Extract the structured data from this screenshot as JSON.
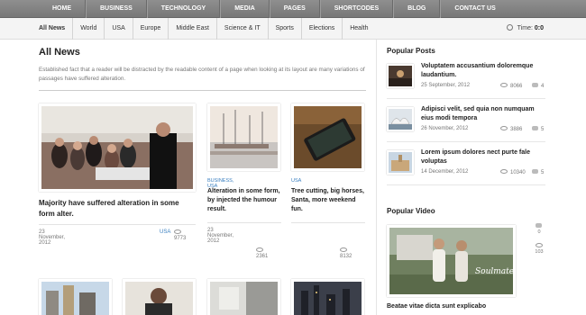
{
  "nav": {
    "items": [
      "HOME",
      "BUSINESS",
      "TECHNOLOGY",
      "MEDIA",
      "PAGES",
      "SHORTCODES",
      "BLOG",
      "CONTACT US"
    ]
  },
  "subnav": {
    "items": [
      "All News",
      "World",
      "USA",
      "Europe",
      "Middle East",
      "Science & IT",
      "Sports",
      "Elections",
      "Health"
    ],
    "time_label": "Time:",
    "time_value": "0:0"
  },
  "main": {
    "title": "All News",
    "intro": "Established fact that a reader will be distracted by the readable content of a page when looking at its layout are many variations of passages have suffered alteration.",
    "featured": {
      "title": "Majority have suffered alteration in some form alter.",
      "date": "23 November, 2012",
      "category": "USA",
      "views": "9773"
    },
    "cards": [
      {
        "category": "BUSINESS, USA",
        "title": "Alteration in some form, by injected the humour result.",
        "date": "23 November, 2012",
        "views": "2361"
      },
      {
        "category": "USA",
        "title": "Tree cutting, big horses, Santa, more weekend fun.",
        "views": "8132"
      }
    ]
  },
  "sidebar": {
    "popular_posts_title": "Popular Posts",
    "posts": [
      {
        "title": "Voluptatem accusantium doloremque laudantium.",
        "date": "25 September, 2012",
        "views": "8066",
        "comments": "4"
      },
      {
        "title": "Adipisci velit, sed quia non numquam eius modi tempora",
        "date": "26 November, 2012",
        "views": "3886",
        "comments": "5"
      },
      {
        "title": "Lorem ipsum dolores nect purte fale voluptas",
        "date": "14 December, 2012",
        "views": "10340",
        "comments": "5"
      }
    ],
    "popular_video_title": "Popular Video",
    "video": {
      "caption": "Beatae vitae dicta sunt explicabo",
      "overlay_text": "Soulmates",
      "likes": "0",
      "views": "103"
    }
  },
  "colors": {
    "nav_bg": "#808080",
    "accent_blue": "#3a7fc0"
  }
}
